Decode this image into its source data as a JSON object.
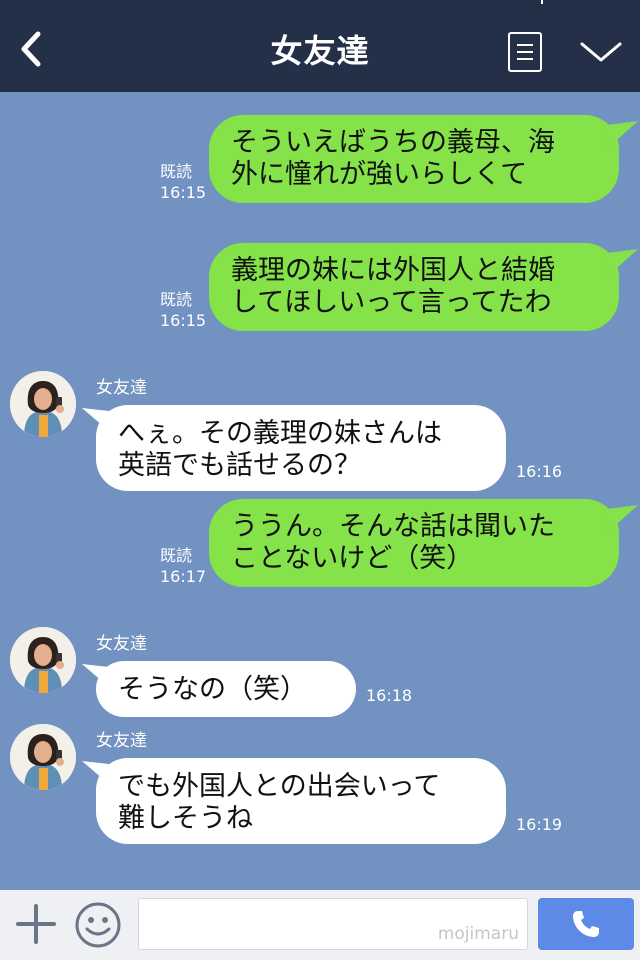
{
  "header": {
    "title": "女友達",
    "back_icon": "chevron-left-icon",
    "menu_icon": "note-icon",
    "expand_icon": "chevron-down-icon"
  },
  "messages": [
    {
      "from": "me",
      "lines": [
        "そういえばうちの義母、海",
        "外に憧れが強いらしくて"
      ],
      "read": "既読",
      "time": "16:15"
    },
    {
      "from": "me",
      "lines": [
        "義理の妹には外国人と結婚",
        "してほしいって言ってたわ"
      ],
      "read": "既読",
      "time": "16:15"
    },
    {
      "from": "them",
      "sender": "女友達",
      "lines": [
        "へぇ。その義理の妹さんは",
        "英語でも話せるの？"
      ],
      "time": "16:16"
    },
    {
      "from": "me",
      "lines": [
        "ううん。そんな話は聞いた",
        "ことないけど（笑）"
      ],
      "read": "既読",
      "time": "16:17"
    },
    {
      "from": "them",
      "sender": "女友達",
      "lines": [
        "そうなの（笑）"
      ],
      "time": "16:18"
    },
    {
      "from": "them",
      "sender": "女友達",
      "lines": [
        "でも外国人との出会いって",
        "難しそうね"
      ],
      "time": "16:19"
    }
  ],
  "footer": {
    "plus_icon": "plus-icon",
    "emoji_icon": "smile-icon",
    "input_value": "",
    "watermark": "mojimaru",
    "call_icon": "phone-icon"
  },
  "colors": {
    "header_bg": "#243047",
    "chat_bg": "#7292c2",
    "my_bubble": "#85e249",
    "their_bubble": "#ffffff",
    "call_button": "#5d8ae6"
  }
}
